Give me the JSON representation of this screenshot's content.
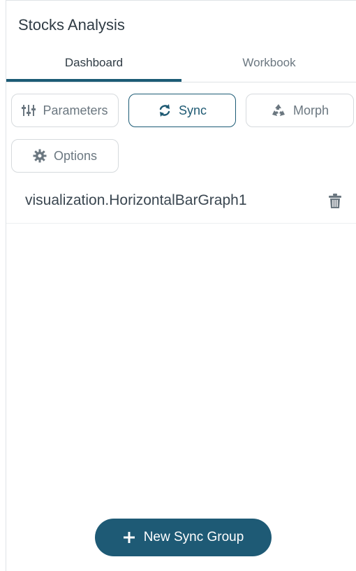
{
  "panel": {
    "title": "Stocks Analysis"
  },
  "tabs": [
    {
      "label": "Dashboard",
      "active": true
    },
    {
      "label": "Workbook",
      "active": false
    }
  ],
  "toolbar": {
    "parameters_label": "Parameters",
    "sync_label": "Sync",
    "morph_label": "Morph",
    "options_label": "Options",
    "active": "Sync"
  },
  "sync_items": [
    {
      "label": "visualization.HorizontalBarGraph1"
    }
  ],
  "footer": {
    "new_sync_group_label": "New Sync Group"
  },
  "colors": {
    "accent": "#1e5a75",
    "border": "#d6dadd",
    "muted_text": "#6b7780"
  },
  "icons": {
    "parameters": "sliders-icon",
    "sync": "sync-icon",
    "morph": "recycle-icon",
    "options": "gear-icon",
    "delete": "trash-icon",
    "add": "plus-icon"
  }
}
